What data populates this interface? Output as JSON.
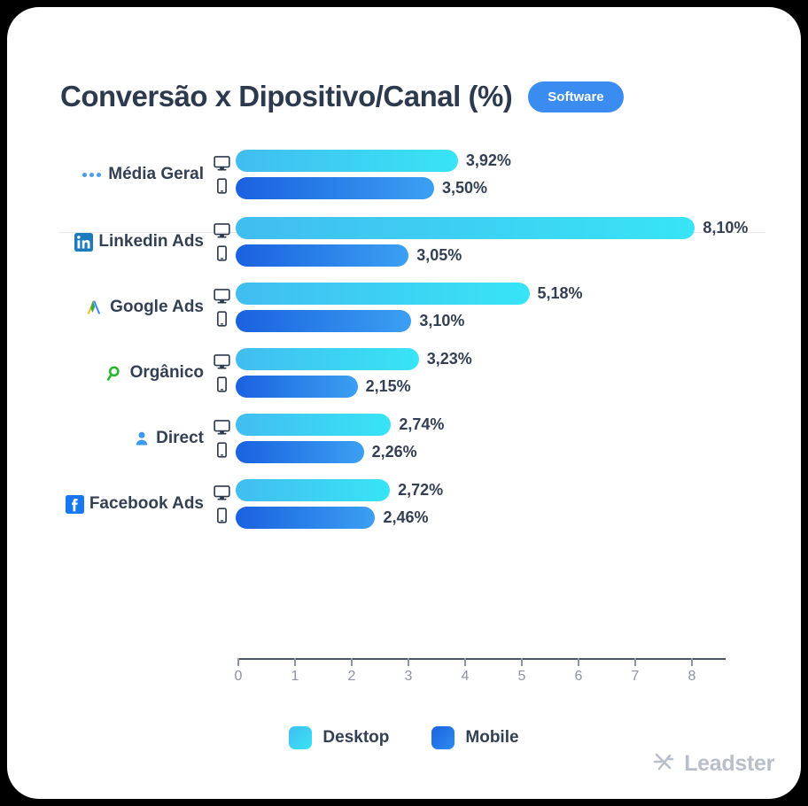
{
  "header": {
    "title": "Conversão x Dipositivo/Canal (%)",
    "badge": "Software"
  },
  "legend": {
    "desktop": "Desktop",
    "mobile": "Mobile",
    "position": "bottom-center"
  },
  "footer": {
    "brand": "Leadster"
  },
  "colors": {
    "desktop_start": "#41bdf0",
    "desktop_end": "#38e4f6",
    "mobile_start": "#1a61e0",
    "mobile_end": "#3ba0f2",
    "badge": "#3b8cf0",
    "text": "#333f52",
    "axis": "#8a94a6",
    "logo": "#b9bfc9"
  },
  "chart_data": {
    "type": "bar",
    "title": "Conversão x Dipositivo/Canal (%)",
    "subtitle": "Software",
    "orientation": "horizontal",
    "xlabel": "",
    "ylabel": "",
    "xlim": [
      0,
      8.6
    ],
    "grid": false,
    "tick_labels": [
      "0",
      "1",
      "2",
      "3",
      "4",
      "5",
      "6",
      "7",
      "8"
    ],
    "ticks": [
      0,
      1,
      2,
      3,
      4,
      5,
      6,
      7,
      8
    ],
    "categories": [
      "Média Geral",
      "Linkedin Ads",
      "Google Ads",
      "Orgânico",
      "Direct",
      "Facebook Ads"
    ],
    "series": [
      {
        "name": "Desktop",
        "values": [
          3.92,
          8.1,
          5.18,
          3.23,
          2.74,
          2.72
        ]
      },
      {
        "name": "Mobile",
        "values": [
          3.5,
          3.05,
          3.1,
          2.15,
          2.26,
          2.46
        ]
      }
    ],
    "rows": [
      {
        "label": "Média Geral",
        "icon": "three-dots-icon",
        "desktop": 3.92,
        "mobile": 3.5,
        "desktop_label": "3,92%",
        "mobile_label": "3,50%"
      },
      {
        "label": "Linkedin Ads",
        "icon": "linkedin-icon",
        "desktop": 8.1,
        "mobile": 3.05,
        "desktop_label": "8,10%",
        "mobile_label": "3,05%"
      },
      {
        "label": "Google Ads",
        "icon": "google-ads-icon",
        "desktop": 5.18,
        "mobile": 3.1,
        "desktop_label": "5,18%",
        "mobile_label": "3,10%"
      },
      {
        "label": "Orgânico",
        "icon": "magnifier-icon",
        "desktop": 3.23,
        "mobile": 2.15,
        "desktop_label": "3,23%",
        "mobile_label": "2,15%"
      },
      {
        "label": "Direct",
        "icon": "person-icon",
        "desktop": 2.74,
        "mobile": 2.26,
        "desktop_label": "2,74%",
        "mobile_label": "2,26%"
      },
      {
        "label": "Facebook Ads",
        "icon": "facebook-icon",
        "desktop": 2.72,
        "mobile": 2.46,
        "desktop_label": "2,72%",
        "mobile_label": "2,46%"
      }
    ]
  }
}
